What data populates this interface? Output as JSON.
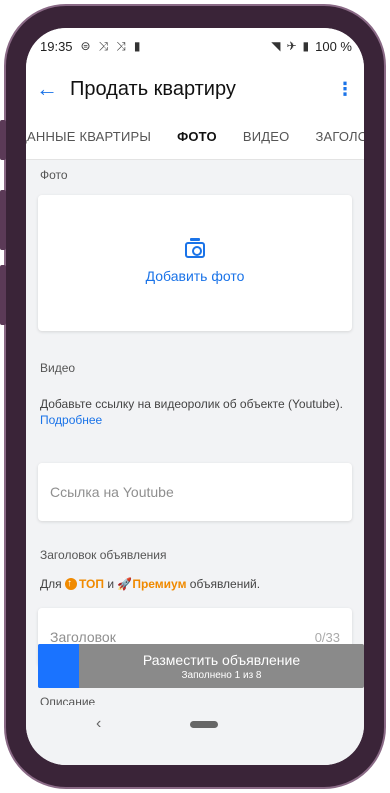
{
  "status": {
    "time": "19:35",
    "battery": "100 %"
  },
  "appbar": {
    "title": "Продать квартиру"
  },
  "tabs": [
    "ДАННЫЕ КВАРТИРЫ",
    "ФОТО",
    "ВИДЕО",
    "ЗАГОЛОВОК"
  ],
  "photo": {
    "label": "Фото",
    "add": "Добавить фото"
  },
  "video": {
    "label": "Видео",
    "hint": "Добавьте ссылку на видеоролик об объекте (Youtube).",
    "more": "Подробнее",
    "placeholder": "Ссылка на Youtube"
  },
  "headline": {
    "label": "Заголовок объявления",
    "for_prefix": "Для",
    "top": "ТОП",
    "and": "и",
    "premium": "Премиум",
    "suffix": "объявлений.",
    "placeholder": "Заголовок",
    "counter": "0/33"
  },
  "description": {
    "label": "Описание"
  },
  "submit": {
    "main": "Разместить объявление",
    "sub": "Заполнено 1 из 8",
    "progress": 0.125
  },
  "colors": {
    "accent": "#1a73e8",
    "orange": "#f08a00",
    "frame": "#3a2438"
  }
}
